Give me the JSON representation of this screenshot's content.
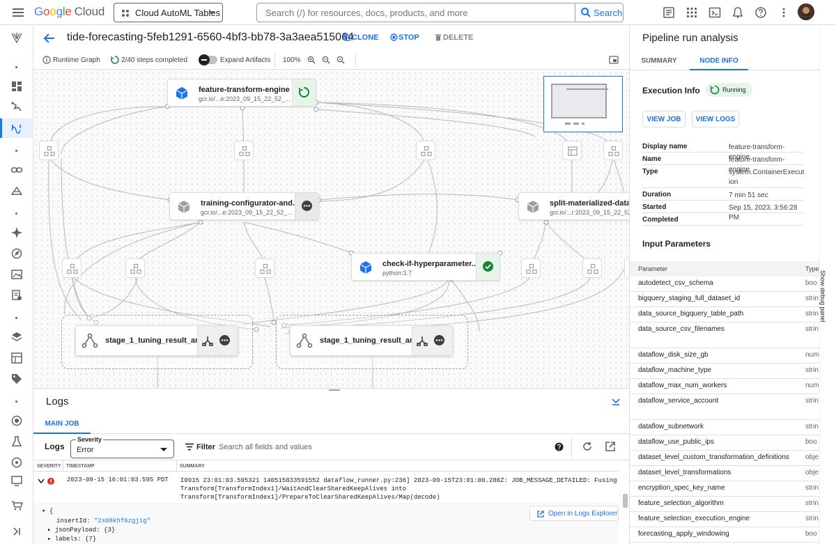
{
  "topbar": {
    "logo": {
      "g": "G",
      "o1": "o",
      "o2": "o",
      "g2": "g",
      "l": "l",
      "e": "e",
      "cloud": "Cloud"
    },
    "project": "Cloud AutoML Tables",
    "search_placeholder": "Search (/) for resources, docs, products, and more",
    "search_button": "Search"
  },
  "header": {
    "title": "tide-forecasting-5feb1291-6560-4bf3-bb78-3a3aea515064",
    "clone": "CLONE",
    "stop": "STOP",
    "delete": "DELETE"
  },
  "toolbar": {
    "runtime_graph": "Runtime Graph",
    "steps": "2/40 steps completed",
    "expand_artifacts": "Expand Artifacts",
    "zoom": "100%"
  },
  "graph": {
    "nodes": [
      {
        "title": "feature-transform-engine",
        "subtitle": "gcr.io/...e:2023_09_15_22_52_...",
        "status": "running"
      },
      {
        "title": "training-configurator-and...",
        "subtitle": "gcr.io/...e:2023_09_15_22_52_...",
        "status": "pending"
      },
      {
        "title": "split-materialized-data",
        "subtitle": "gcr.io/...r:2023_09_15_22_52_...",
        "status": "pending"
      },
      {
        "title": "check-if-hyperparameter...",
        "subtitle": "python:3.7",
        "status": "succeeded"
      }
    ],
    "groups": [
      {
        "title": "stage_1_tuning_result_ar..."
      },
      {
        "title": "stage_1_tuning_result_ar..."
      }
    ]
  },
  "logs": {
    "title": "Logs",
    "tab": "MAIN JOB",
    "label": "Logs",
    "severity_label": "Severity",
    "severity_value": "Error",
    "filter": "Filter",
    "search_placeholder": "Search all fields and values",
    "columns": [
      "SEVERITY",
      "TIMESTAMP",
      "SUMMARY"
    ],
    "entry": {
      "timestamp": "2023-09-15 16:01:03.595 PDT",
      "summary_1": "I0915 23:01:03.595321 140515833591552 dataflow_runner.py:236] 2023-09-15T23:01:00.280Z: JOB_MESSAGE_DETAILED: Fusing consumer",
      "summary_2": "Transform[TransformIndex1]/WaitAndClearSharedKeepAlives into",
      "summary_3": "Transform[TransformIndex1]/PrepareToClearSharedKeepAlives/Map(decode)"
    },
    "json": {
      "open": "{",
      "insert_key": "insertId:",
      "insert_val": "\"2s08khf6zgjig\"",
      "payload": "jsonPayload: {3}",
      "labels": "labels: {7}"
    },
    "open_explorer": "Open in Logs Explorer"
  },
  "panel": {
    "title": "Pipeline run analysis",
    "tabs": [
      "SUMMARY",
      "NODE INFO"
    ],
    "exec_info": "Execution Info",
    "status": "Running",
    "view_job": "VIEW JOB",
    "view_logs": "VIEW LOGS",
    "details": [
      {
        "key": "Display name",
        "value": "feature-transform-engine"
      },
      {
        "key": "Name",
        "value": "feature-transform-engine"
      },
      {
        "key": "Type",
        "value": "system.ContainerExecution"
      },
      {
        "key": "Duration",
        "value": "7 min 51 sec"
      },
      {
        "key": "Started",
        "value": "Sep 15, 2023, 3:56:28 PM"
      },
      {
        "key": "Completed",
        "value": ""
      }
    ],
    "input_params": "Input Parameters",
    "param_cols": [
      "Parameter",
      "Type"
    ],
    "params": [
      {
        "name": "autodetect_csv_schema",
        "type": "boo"
      },
      {
        "name": "bigquery_staging_full_dataset_id",
        "type": "strin"
      },
      {
        "name": "data_source_bigquery_table_path",
        "type": "strin"
      },
      {
        "name": "data_source_csv_filenames",
        "type": "strin"
      },
      {
        "name": "dataflow_disk_size_gb",
        "type": "num"
      },
      {
        "name": "dataflow_machine_type",
        "type": "strin"
      },
      {
        "name": "dataflow_max_num_workers",
        "type": "num"
      },
      {
        "name": "dataflow_service_account",
        "type": "strin"
      },
      {
        "name": "dataflow_subnetwork",
        "type": "strin"
      },
      {
        "name": "dataflow_use_public_ips",
        "type": "boo"
      },
      {
        "name": "dataset_level_custom_transformation_definitions",
        "type": "obje"
      },
      {
        "name": "dataset_level_transformations",
        "type": "obje"
      },
      {
        "name": "encryption_spec_key_name",
        "type": "strin"
      },
      {
        "name": "feature_selection_algorithm",
        "type": "strin"
      },
      {
        "name": "feature_selection_execution_engine",
        "type": "strin"
      },
      {
        "name": "forecasting_apply_windowing",
        "type": "boo"
      }
    ],
    "debug": "Show debug panel"
  },
  "colors": {
    "accent": "#1a73e8",
    "success": "#188038",
    "running": "#34a853",
    "error": "#d93025"
  }
}
